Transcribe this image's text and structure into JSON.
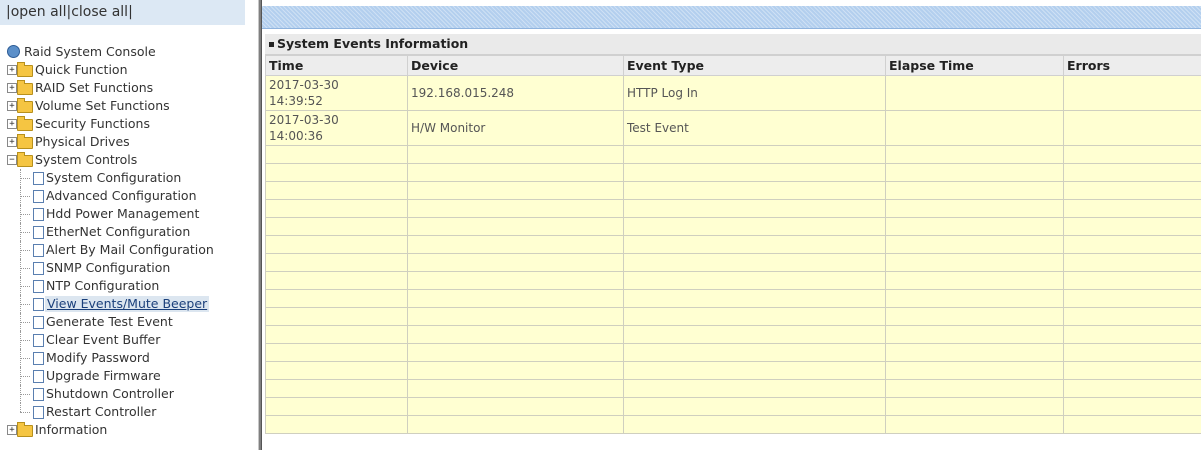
{
  "left_frame": {
    "open_close": {
      "sep1": "|",
      "open_all": "open all",
      "sep2": "|",
      "close_all": "close all",
      "sep3": "|"
    },
    "root": {
      "label": "Raid System Console"
    },
    "tree": {
      "quick_function": "Quick Function",
      "raid_set_functions": "RAID Set Functions",
      "volume_set_functions": "Volume Set Functions",
      "security_functions": "Security Functions",
      "physical_drives": "Physical Drives",
      "system_controls": "System Controls",
      "information": "Information",
      "collapsed_symbol": "+",
      "expanded_symbol": "−"
    },
    "system_controls_items": {
      "system_configuration": "System Configuration",
      "advanced_configuration": "Advanced Configuration",
      "hdd_power_management": "Hdd Power Management",
      "ethernet_configuration": "EtherNet Configuration",
      "alert_by_mail_configuration": "Alert By Mail Configuration",
      "snmp_configuration": "SNMP Configuration",
      "ntp_configuration": "NTP Configuration",
      "view_events_mute_beeper": "View Events/Mute Beeper",
      "generate_test_event": "Generate Test Event",
      "clear_event_buffer": "Clear Event Buffer",
      "modify_password": "Modify Password",
      "upgrade_firmware": "Upgrade Firmware",
      "shutdown_controller": "Shutdown Controller",
      "restart_controller": "Restart Controller"
    },
    "selected_item": "View Events/Mute Beeper"
  },
  "events_panel": {
    "title": "System Events Information",
    "columns": {
      "time": "Time",
      "device": "Device",
      "event_type": "Event Type",
      "elapse_time": "Elapse Time",
      "errors": "Errors"
    },
    "rows": [
      {
        "date": "2017-03-30",
        "time": "14:39:52",
        "device": "192.168.015.248",
        "event_type": "HTTP Log In",
        "elapse_time": "",
        "errors": ""
      },
      {
        "date": "2017-03-30",
        "time": "14:00:36",
        "device": "H/W Monitor",
        "event_type": "Test Event",
        "elapse_time": "",
        "errors": ""
      }
    ]
  },
  "colors": {
    "tree_header_bg": "#dce8f4",
    "top_strip": "#b3cfee",
    "table_cell_bg": "#ffffd2",
    "table_header_bg": "#ededed",
    "folder_icon": "#f5c542",
    "selected_text": "#1a3f7a"
  },
  "icons": {
    "root": "raid-console-icon",
    "folder": "folder-icon",
    "document": "document-icon",
    "expander": "tree-expander-icon"
  }
}
